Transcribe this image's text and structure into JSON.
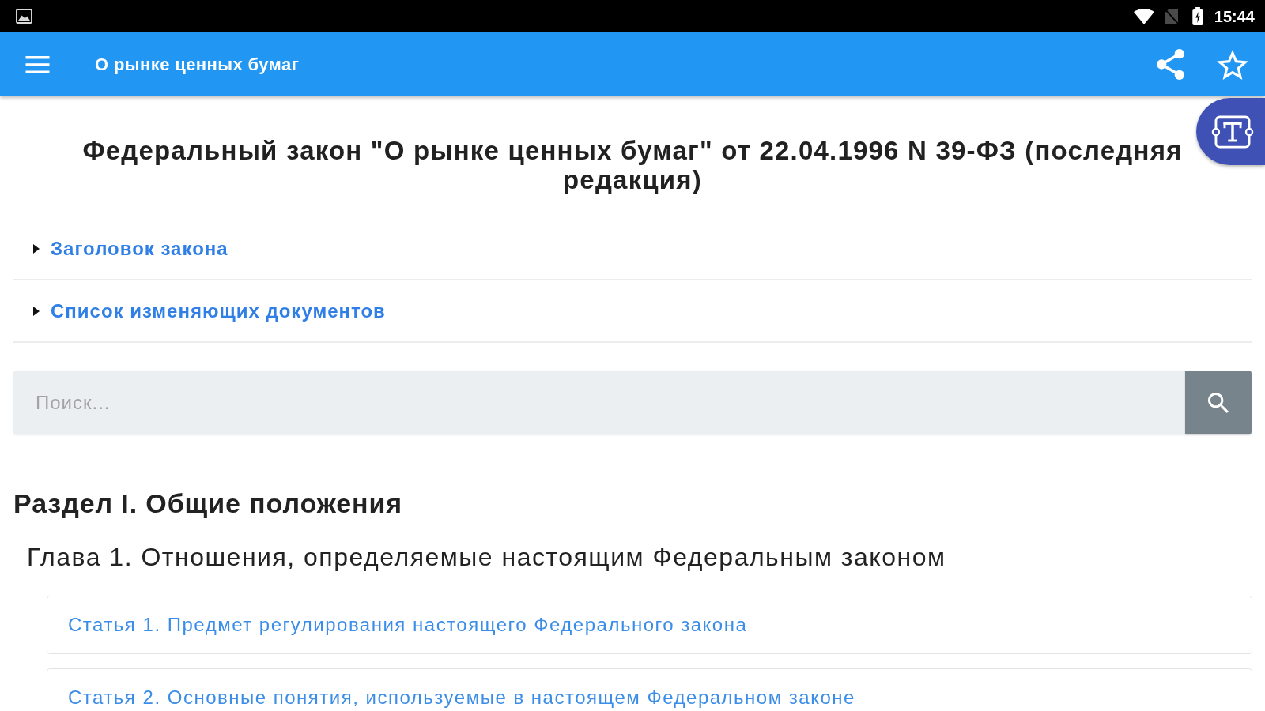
{
  "status_bar": {
    "time": "15:44"
  },
  "app_bar": {
    "title": "О рынке ценных бумаг"
  },
  "document_title": "Федеральный закон \"О рынке ценных бумаг\" от 22.04.1996 N 39-ФЗ (последняя редакция)",
  "collapsibles": [
    {
      "label": "Заголовок закона",
      "expanded": false
    },
    {
      "label": "Список изменяющих документов",
      "expanded": false
    }
  ],
  "search": {
    "placeholder": "Поиск..."
  },
  "toc": [
    {
      "title": "Раздел I. Общие положения",
      "children": [
        {
          "title": "Глава 1. Отношения, определяемые настоящим Федеральным законом",
          "children": [
            {
              "title": "Статья 1. Предмет регулирования настоящего Федерального закона"
            },
            {
              "title": "Статья 2. Основные понятия, используемые в настоящем Федеральном законе"
            }
          ]
        }
      ]
    }
  ]
}
